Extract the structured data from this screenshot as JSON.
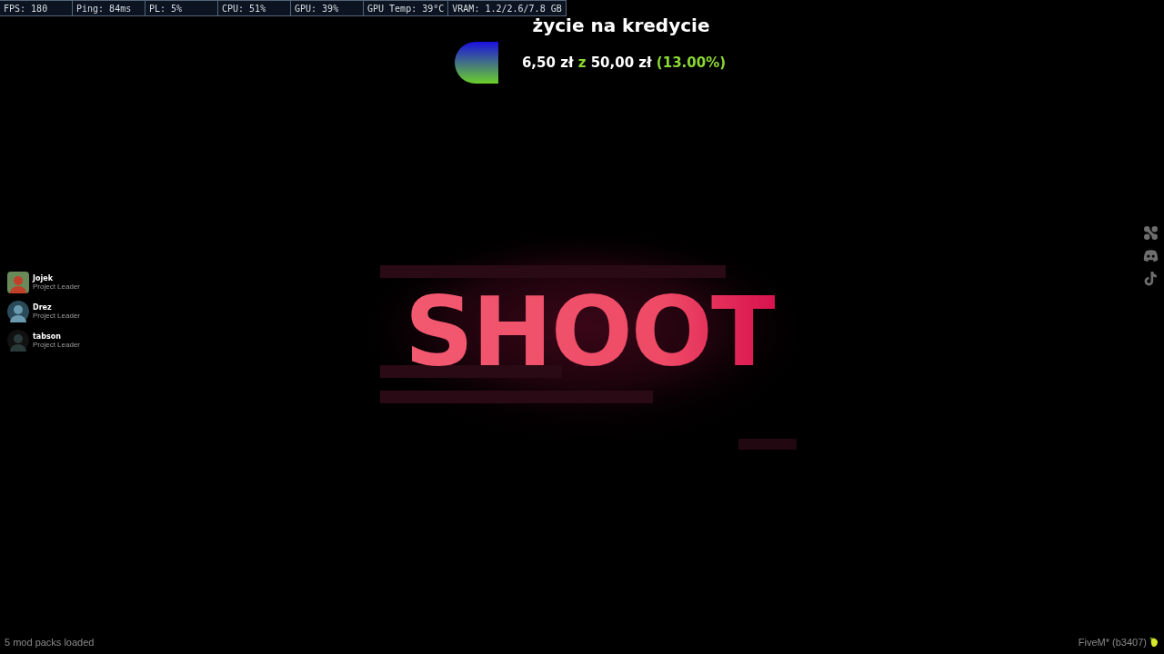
{
  "stats_bar": [
    {
      "text": "FPS: 180"
    },
    {
      "text": "Ping: 84ms"
    },
    {
      "text": "PL: 5%"
    },
    {
      "text": "CPU: 51%"
    },
    {
      "text": "GPU: 39%"
    },
    {
      "text": "GPU Temp: 39°C"
    },
    {
      "text": "VRAM: 1.2/2.6/7.8 GB"
    }
  ],
  "donation_goal": {
    "title": "życie na kredycie",
    "raised": "6,50 zł",
    "separator": "z",
    "goal": "50,00 zł",
    "percent": "(13.00%)"
  },
  "team": [
    {
      "name": "Jojek",
      "role": "Project Leader"
    },
    {
      "name": "Drez",
      "role": "Project Leader"
    },
    {
      "name": "tabson",
      "role": "Project Leader"
    }
  ],
  "logo": {
    "text": "SHOOT"
  },
  "footer": {
    "status": "5 mod packs loaded",
    "version": "FiveM* (b3407)"
  }
}
